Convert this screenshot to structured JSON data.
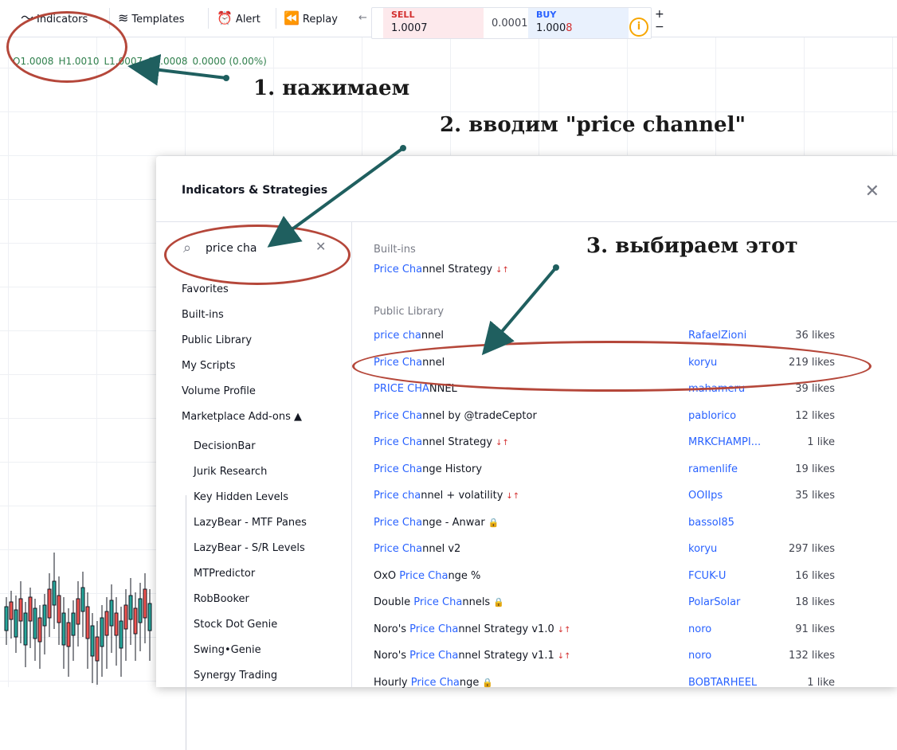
{
  "toolbar": {
    "indicators": "Indicators",
    "templates": "Templates",
    "alert": "Alert",
    "replay": "Replay",
    "sell_label": "SELL",
    "sell_price": "1.0007",
    "spread": "0.0001",
    "buy_label": "BUY",
    "buy_price_main": "1.000",
    "buy_price_last": "8",
    "zoom_in": "+",
    "zoom_out": "−"
  },
  "ohlc": {
    "open": "O1.0008",
    "high": "H1.0010",
    "low": "L1.0007",
    "close": "C1.0008",
    "change": "0.0000 (0.00%)"
  },
  "annotations": {
    "step1": "1. нажимаем",
    "step2": "2. вводим \"price channel\"",
    "step3": "3. выбираем этот"
  },
  "dialog": {
    "title": "Indicators & Strategies",
    "search_value": "price cha",
    "categories": [
      "Favorites",
      "Built-ins",
      "Public Library",
      "My Scripts",
      "Volume Profile",
      "Marketplace Add-ons ▲"
    ],
    "subcategories": [
      "DecisionBar",
      "Jurik Research",
      "Key Hidden Levels",
      "LazyBear - MTF Panes",
      "LazyBear - S/R Levels",
      "MTPredictor",
      "RobBooker",
      "Stock Dot Genie",
      "Swing•Genie",
      "Synergy Trading"
    ],
    "builtins_header": "Built-ins",
    "builtins": [
      {
        "hl": "Price Cha",
        "rest": "nnel Strategy",
        "strategy": "↓↑"
      }
    ],
    "public_header": "Public Library",
    "results": [
      {
        "pre": "",
        "hl": "price cha",
        "rest": "nnel",
        "author": "RafaelZioni",
        "likes": "36 likes"
      },
      {
        "pre": "",
        "hl": "Price Cha",
        "rest": "nnel",
        "author": "koryu",
        "likes": "219 likes"
      },
      {
        "pre": "",
        "hl": "PRICE CHA",
        "rest": "NNEL",
        "author": "mahameru",
        "likes": "39 likes"
      },
      {
        "pre": "",
        "hl": "Price Cha",
        "rest": "nnel by @tradeCeptor",
        "author": "pablorico",
        "likes": "12 likes"
      },
      {
        "pre": "",
        "hl": "Price Cha",
        "rest": "nnel Strategy",
        "strategy": "↓↑",
        "author": "MRKCHAMPI...",
        "likes": "1 like"
      },
      {
        "pre": "",
        "hl": "Price Cha",
        "rest": "nge History",
        "author": "ramenlife",
        "likes": "19 likes"
      },
      {
        "pre": "",
        "hl": "Price cha",
        "rest": "nnel + volatility",
        "strategy": "↓↑",
        "author": "OOIIps",
        "likes": "35 likes"
      },
      {
        "pre": "",
        "hl": "Price Cha",
        "rest": "nge - Anwar",
        "lock": "🔒",
        "author": "bassol85",
        "likes": ""
      },
      {
        "pre": "",
        "hl": "Price Cha",
        "rest": "nnel v2",
        "author": "koryu",
        "likes": "297 likes"
      },
      {
        "pre": "OxO ",
        "hl": "Price Cha",
        "rest": "nge %",
        "author": "FCUK-U",
        "likes": "16 likes"
      },
      {
        "pre": "Double ",
        "hl": "Price Cha",
        "rest": "nnels",
        "lock": "🔒",
        "author": "PolarSolar",
        "likes": "18 likes"
      },
      {
        "pre": "Noro's ",
        "hl": "Price Cha",
        "rest": "nnel Strategy v1.0",
        "strategy": "↓↑",
        "author": "noro",
        "likes": "91 likes"
      },
      {
        "pre": "Noro's ",
        "hl": "Price Cha",
        "rest": "nnel Strategy v1.1",
        "strategy": "↓↑",
        "author": "noro",
        "likes": "132 likes"
      },
      {
        "pre": "Hourly ",
        "hl": "Price Cha",
        "rest": "nge",
        "lock": "🔒",
        "author": "BOBTARHEEL",
        "likes": "1 like"
      }
    ]
  },
  "colors": {
    "accent": "#2962ff",
    "annotation_ring": "#b5473a",
    "annotation_arrow": "#1f5f5f",
    "sell_bg": "#fde9ec",
    "buy_bg": "#e9f1fd"
  }
}
